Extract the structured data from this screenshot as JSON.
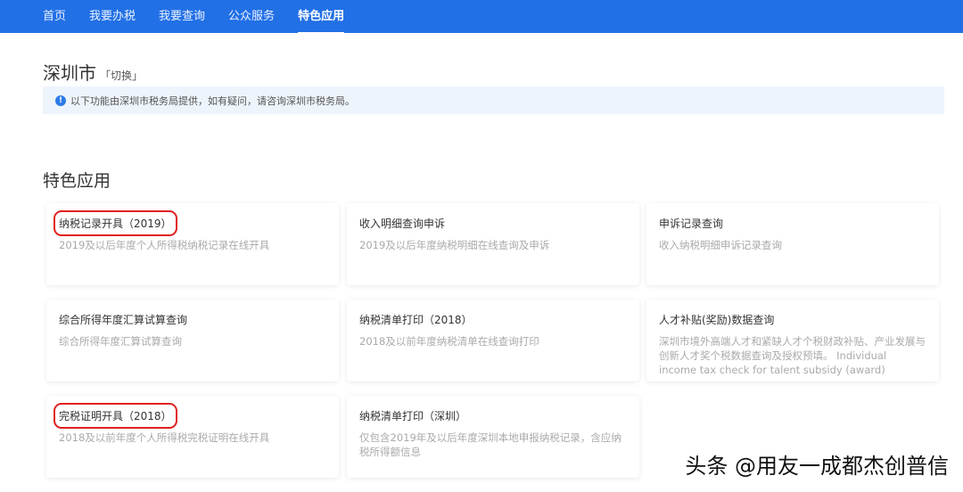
{
  "nav": [
    "首页",
    "我要办税",
    "我要查询",
    "公众服务",
    "特色应用"
  ],
  "city": {
    "name": "深圳市",
    "switch": "「切换」"
  },
  "notice": {
    "icon": "!",
    "text": "以下功能由深圳市税务局提供，如有疑问，请咨询深圳市税务局。"
  },
  "section_title": "特色应用",
  "cards": [
    {
      "title": "纳税记录开具（2019）",
      "desc": "2019及以后年度个人所得税纳税记录在线开具"
    },
    {
      "title": "收入明细查询申诉",
      "desc": "2019及以后年度纳税明细在线查询及申诉"
    },
    {
      "title": "申诉记录查询",
      "desc": "收入纳税明细申诉记录查询"
    },
    {
      "title": "综合所得年度汇算试算查询",
      "desc": "综合所得年度汇算试算查询"
    },
    {
      "title": "纳税清单打印（2018）",
      "desc": "2018及以前年度纳税清单在线查询打印"
    },
    {
      "title": "人才补贴(奖励)数据查询",
      "desc": "深圳市境外高端人才和紧缺人才个税财政补贴、产业发展与创新人才奖个税数据查询及授权预填。 Individual income tax check for talent subsidy (award)"
    },
    {
      "title": "完税证明开具（2018）",
      "desc": "2018及以前年度个人所得税完税证明在线开具"
    },
    {
      "title": "纳税清单打印（深圳）",
      "desc": "仅包含2019年及以后年度深圳本地申报纳税记录，含应纳税所得额信息"
    }
  ],
  "watermark": "头条 @用友一成都杰创普信"
}
